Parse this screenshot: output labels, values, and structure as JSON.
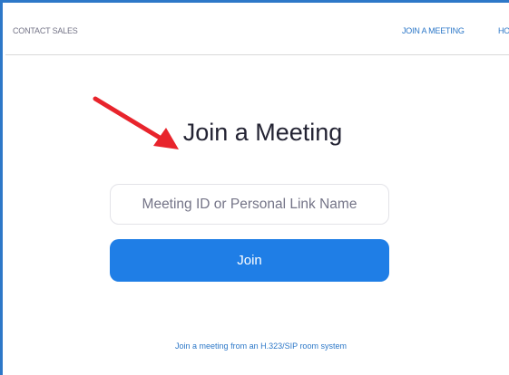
{
  "header": {
    "contact_sales": "CONTACT SALES",
    "join_meeting": "JOIN A MEETING",
    "host_meeting": "HOST A MEETING"
  },
  "main": {
    "title": "Join a Meeting",
    "input_placeholder": "Meeting ID or Personal Link Name",
    "input_value": "",
    "join_label": "Join",
    "sip_link": "Join a meeting from an H.323/SIP room system"
  },
  "annotation": {
    "arrow_icon": "red-arrow-icon",
    "arrow_color": "#e8242c"
  },
  "colors": {
    "frame_border": "#2d78c8",
    "link": "#2d78c8",
    "primary_button": "#1f7ee6",
    "title_text": "#232333",
    "muted_text": "#747487"
  }
}
